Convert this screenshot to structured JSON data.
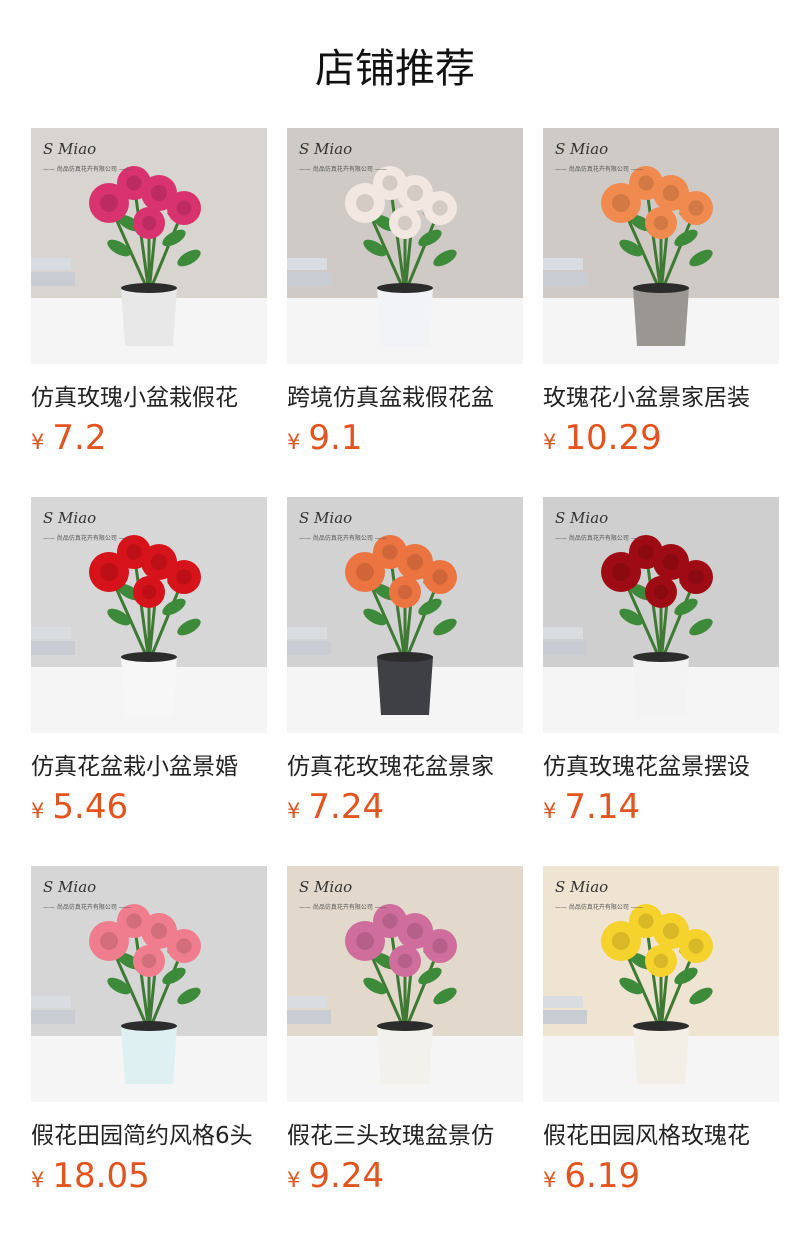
{
  "header": {
    "title": "店铺推荐"
  },
  "brand": {
    "logo_text": "S Miao",
    "sub_text": "—— 尚品仿真花卉有限公司 ——"
  },
  "products": [
    {
      "name": "仿真玫瑰小盆栽假花",
      "currency": "¥",
      "price": "7.2",
      "flower_color": "#d8336f",
      "bg": "#d8d4d0",
      "pot": "#e8e8e8"
    },
    {
      "name": "跨境仿真盆栽假花盆",
      "currency": "¥",
      "price": "9.1",
      "flower_color": "#f3e7e1",
      "bg": "#cfcac6",
      "pot": "#f1f3f6"
    },
    {
      "name": "玫瑰花小盆景家居装",
      "currency": "¥",
      "price": "10.29",
      "flower_color": "#f08a4e",
      "bg": "#cfcac6",
      "pot": "#9a9792"
    },
    {
      "name": "仿真花盆栽小盆景婚",
      "currency": "¥",
      "price": "5.46",
      "flower_color": "#d6121b",
      "bg": "#d7d7d7",
      "pot": "#f7f7f7"
    },
    {
      "name": "仿真花玫瑰花盆景家",
      "currency": "¥",
      "price": "7.24",
      "flower_color": "#ec7440",
      "bg": "#d2d2d2",
      "pot": "#3f4046"
    },
    {
      "name": "仿真玫瑰花盆景摆设",
      "currency": "¥",
      "price": "7.14",
      "flower_color": "#9f0b14",
      "bg": "#cfcfcf",
      "pot": "#f3f3f3"
    },
    {
      "name": "假花田园简约风格6头",
      "currency": "¥",
      "price": "18.05",
      "flower_color": "#ef7d8d",
      "bg": "#d6d6d6",
      "pot": "#dff0f2"
    },
    {
      "name": "假花三头玫瑰盆景仿",
      "currency": "¥",
      "price": "9.24",
      "flower_color": "#cf6d9d",
      "bg": "#e2d8cc",
      "pot": "#f3f1ec"
    },
    {
      "name": "假花田园风格玫瑰花",
      "currency": "¥",
      "price": "6.19",
      "flower_color": "#f6d22c",
      "bg": "#efe4d2",
      "pot": "#f3eee6"
    }
  ]
}
